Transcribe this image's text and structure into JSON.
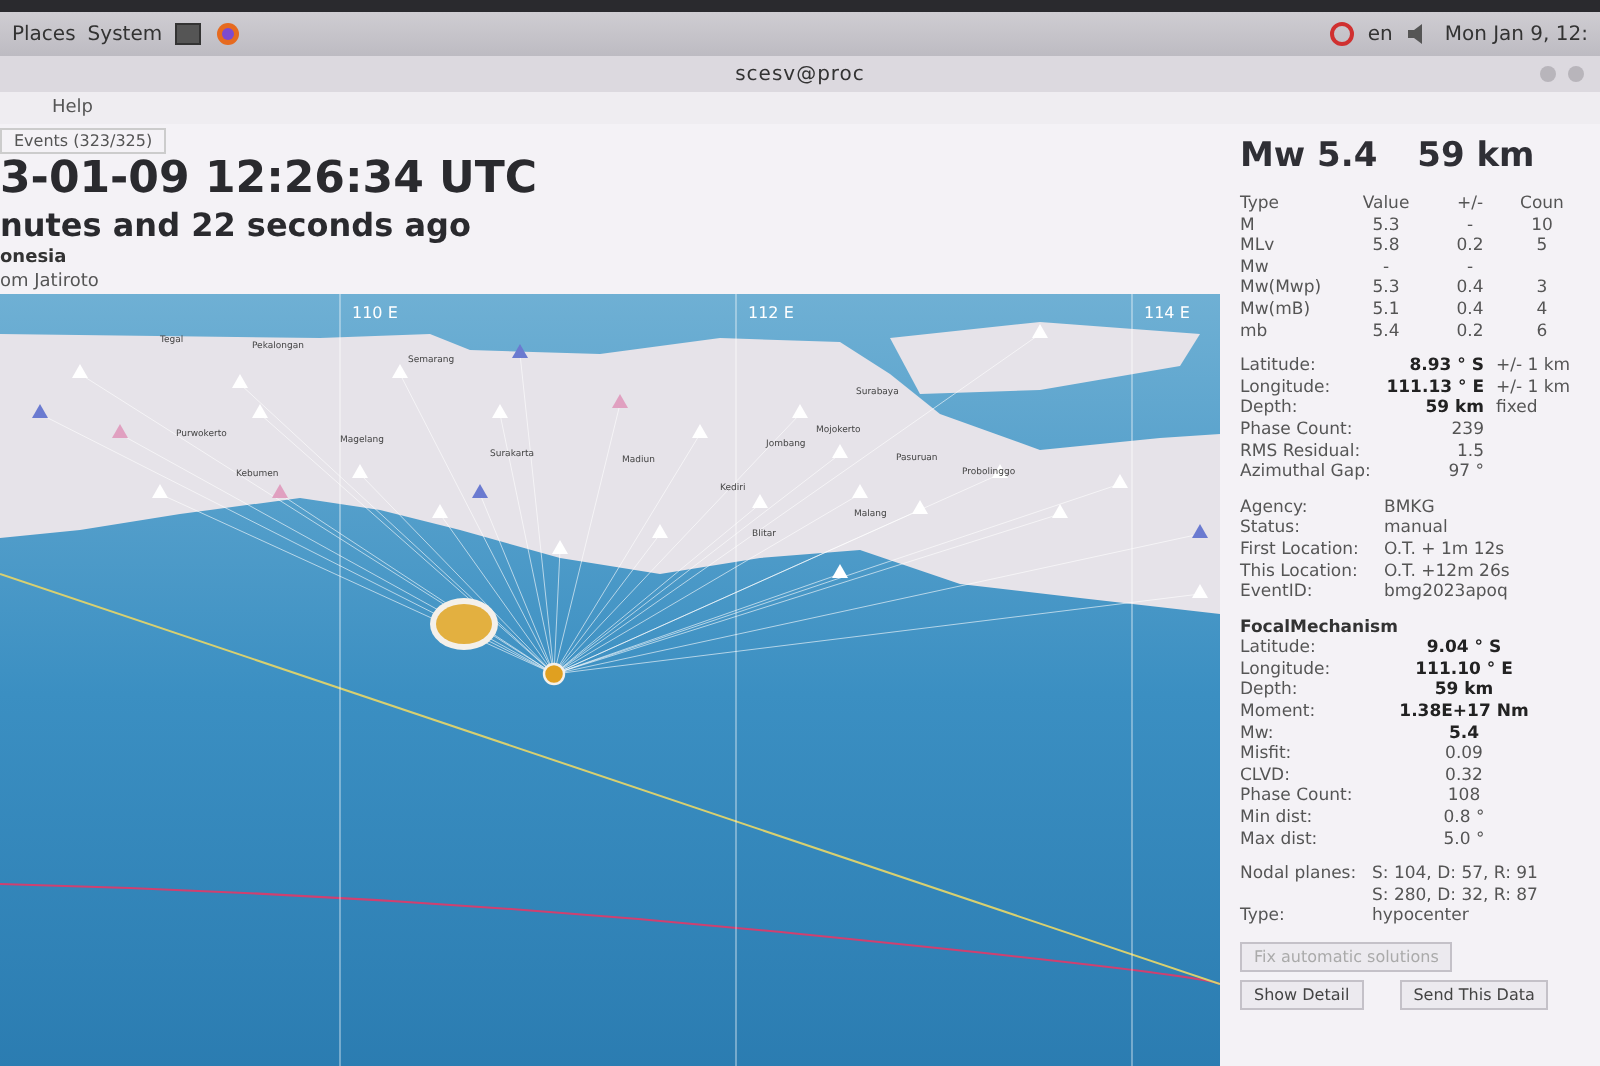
{
  "panel": {
    "menus": [
      "Places",
      "System"
    ],
    "keyboard": "en",
    "clock": "Mon Jan  9, 12:"
  },
  "window": {
    "title": "scesv@proc"
  },
  "menu": [
    "Help"
  ],
  "tabs": [
    {
      "label": "Events (323/325)",
      "selected": true
    }
  ],
  "event": {
    "time": "3-01-09 12:26:34 UTC",
    "age": "nutes and 22 seconds ago",
    "region": "onesia",
    "nearest": "om Jatiroto"
  },
  "map": {
    "grid_labels": [
      "110 E",
      "112 E",
      "114 E"
    ],
    "places": [
      "Tegal",
      "Pekalongan",
      "Semarang",
      "Purwokerto",
      "Magelang",
      "Kebumen",
      "Surakarta",
      "Madiun",
      "Jombang",
      "Mojokerto",
      "Surabaya",
      "Pasuruan",
      "Probolinggo",
      "Kediri",
      "Blitar",
      "Malang"
    ]
  },
  "summary": {
    "magnitude": "Mw 5.4",
    "depth": "59 km"
  },
  "magnitudes": {
    "columns": [
      "Type",
      "Value",
      "+/-",
      "Coun"
    ],
    "rows": [
      [
        "M",
        "5.3",
        "-",
        "10"
      ],
      [
        "MLv",
        "5.8",
        "0.2",
        "5"
      ],
      [
        "Mw",
        "-",
        "-",
        ""
      ],
      [
        "Mw(Mwp)",
        "5.3",
        "0.4",
        "3"
      ],
      [
        "Mw(mB)",
        "5.1",
        "0.4",
        "4"
      ],
      [
        "mb",
        "5.4",
        "0.2",
        "6"
      ]
    ]
  },
  "origin": [
    {
      "label": "Latitude:",
      "value": "8.93 ° S",
      "note": "+/-  1 km",
      "bold": true
    },
    {
      "label": "Longitude:",
      "value": "111.13 ° E",
      "note": "+/-  1 km",
      "bold": true
    },
    {
      "label": "Depth:",
      "value": "59 km",
      "note": "fixed",
      "bold": true
    },
    {
      "label": "Phase Count:",
      "value": "239",
      "bold": false
    },
    {
      "label": "RMS Residual:",
      "value": "1.5",
      "bold": false
    },
    {
      "label": "Azimuthal Gap:",
      "value": "97 °",
      "bold": false
    }
  ],
  "info": [
    {
      "label": "Agency:",
      "value": "BMKG"
    },
    {
      "label": "Status:",
      "value": "manual"
    },
    {
      "label": "First Location:",
      "value": "O.T. + 1m 12s"
    },
    {
      "label": "This Location:",
      "value": "O.T. +12m 26s"
    },
    {
      "label": "EventID:",
      "value": "bmg2023apoq"
    }
  ],
  "focal": {
    "title": "FocalMechanism",
    "rows": [
      {
        "label": "Latitude:",
        "value": "9.04 ° S",
        "bold": true
      },
      {
        "label": "Longitude:",
        "value": "111.10 ° E",
        "bold": true
      },
      {
        "label": "Depth:",
        "value": "59 km",
        "bold": true
      },
      {
        "label": "Moment:",
        "value": "1.38E+17 Nm",
        "bold": true
      },
      {
        "label": "Mw:",
        "value": "5.4",
        "bold": true
      },
      {
        "label": "Misfit:",
        "value": "0.09",
        "bold": false
      },
      {
        "label": "CLVD:",
        "value": "0.32",
        "bold": false
      },
      {
        "label": "Phase Count:",
        "value": "108",
        "bold": false
      },
      {
        "label": "Min dist:",
        "value": "0.8 °",
        "bold": false
      },
      {
        "label": "Max dist:",
        "value": "5.0 °",
        "bold": false
      }
    ],
    "nodal_label": "Nodal planes:",
    "nodal_planes": [
      "S: 104, D: 57, R: 91",
      "S: 280, D: 32, R: 87"
    ],
    "type_label": "Type:",
    "type": "hypocenter"
  },
  "buttons": [
    {
      "label": "Fix automatic solutions",
      "disabled": true
    },
    {
      "label": "Show Detail",
      "disabled": false
    },
    {
      "label": "Send This Data",
      "disabled": false
    }
  ]
}
